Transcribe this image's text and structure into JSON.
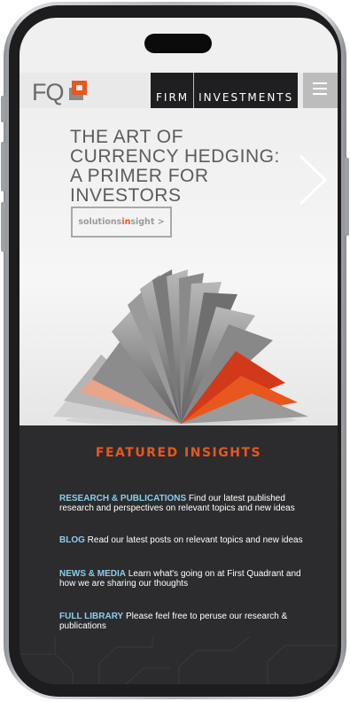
{
  "header": {
    "logo_text": "FQ",
    "nav": [
      "FIRM",
      "INVESTMENTS"
    ]
  },
  "hero": {
    "title": "THE ART OF CURRENCY HEDGING: A PRIMER FOR INVESTORS",
    "button": {
      "part1": "solutions",
      "part2": "in",
      "part3": "sight >"
    }
  },
  "featured": {
    "title": "FEATURED INSIGHTS",
    "items": [
      {
        "label": "RESEARCH & PUBLICATIONS",
        "text": " Find our latest published research and perspectives on relevant topics and new ideas"
      },
      {
        "label": "BLOG",
        "text": " Read our latest posts on relevant topics and new ideas"
      },
      {
        "label": "NEWS & MEDIA",
        "text": " Learn what's going on at First Quadrant and how we are sharing our thoughts"
      },
      {
        "label": "FULL LIBRARY",
        "text": " Please feel free to peruse our research & publications"
      }
    ]
  },
  "colors": {
    "accent": "#e8571e",
    "link": "#8ccde8",
    "dark_bg": "#2c2c2e"
  }
}
